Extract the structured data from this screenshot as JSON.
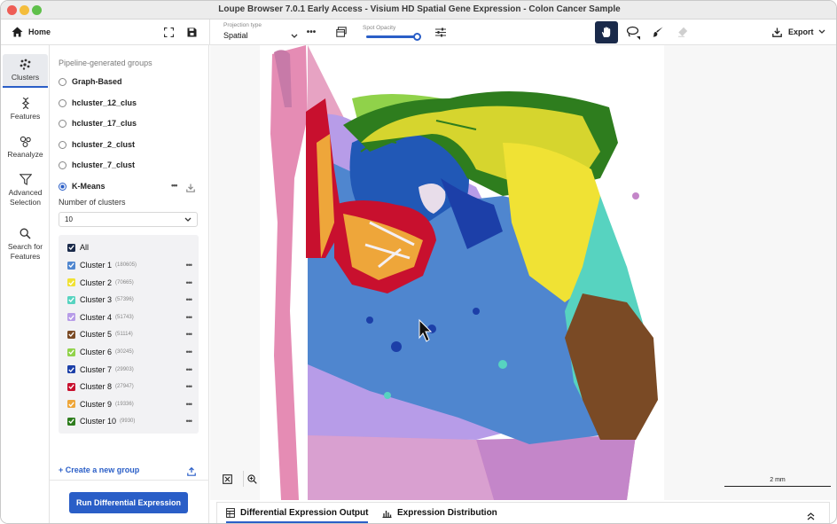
{
  "window": {
    "title": "Loupe Browser 7.0.1 Early Access - Visium HD Spatial Gene Expression - Colon Cancer Sample"
  },
  "header": {
    "home_label": "Home",
    "projection_label": "Projection type",
    "projection_value": "Spatial",
    "opacity_label": "Spot Opacity",
    "opacity_value": 0.95,
    "export_label": "Export"
  },
  "rail": {
    "clusters": "Clusters",
    "features": "Features",
    "reanalyze": "Reanalyze",
    "advanced_1": "Advanced",
    "advanced_2": "Selection",
    "search_1": "Search for",
    "search_2": "Features"
  },
  "panel": {
    "section_title": "Pipeline-generated groups",
    "groups": [
      "Graph-Based",
      "hcluster_12_clus",
      "hcluster_17_clus",
      "hcluster_2_clust",
      "hcluster_7_clust",
      "K-Means"
    ],
    "selected_group": "K-Means",
    "num_clusters_label": "Number of clusters",
    "num_clusters_value": "10",
    "all_label": "All",
    "clusters": [
      {
        "name": "Cluster 1",
        "count": "(180605)",
        "color": "#4f86cf"
      },
      {
        "name": "Cluster 2",
        "count": "(70665)",
        "color": "#f0e234"
      },
      {
        "name": "Cluster 3",
        "count": "(57396)",
        "color": "#57d3c0"
      },
      {
        "name": "Cluster 4",
        "count": "(51743)",
        "color": "#b79ce8"
      },
      {
        "name": "Cluster 5",
        "count": "(51114)",
        "color": "#7a4a25"
      },
      {
        "name": "Cluster 6",
        "count": "(30245)",
        "color": "#90d24a"
      },
      {
        "name": "Cluster 7",
        "count": "(29903)",
        "color": "#1c3fa8"
      },
      {
        "name": "Cluster 8",
        "count": "(27947)",
        "color": "#c8102e"
      },
      {
        "name": "Cluster 9",
        "count": "(19336)",
        "color": "#eea63a"
      },
      {
        "name": "Cluster 10",
        "count": "(9930)",
        "color": "#2e7d1e"
      }
    ],
    "create_group": "+ Create a new group",
    "run_button": "Run Differential Expression"
  },
  "map": {
    "scale_label": "2 mm"
  },
  "bottom": {
    "tab1": "Differential Expression Output",
    "tab2": "Expression Distribution"
  }
}
